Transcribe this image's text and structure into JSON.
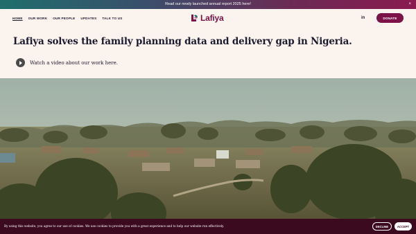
{
  "announcement": {
    "text": "Read our newly launched annual report 2025 here!",
    "close": "×"
  },
  "nav": {
    "items": [
      "HOME",
      "OUR WORK",
      "OUR PEOPLE",
      "UPDATES",
      "TALK TO US"
    ],
    "active": "HOME"
  },
  "logo": {
    "text": "Lafiya"
  },
  "header_right": {
    "linkedin": "in",
    "donate": "DONATE"
  },
  "hero_text": {
    "headline": "Lafiya solves the family planning data and delivery gap in Nigeria.",
    "video_link": "Watch a video about our work here."
  },
  "cookie": {
    "message": "By using this website, you agree to our use of cookies. We use cookies to provide you with a great experience and to help our website run effectively.",
    "decline": "DECLINE",
    "accept": "ACCEPT"
  },
  "colors": {
    "brand": "#7b1248",
    "text": "#1b1b2e",
    "background": "#fbf3ee",
    "cookie_bar": "#3b0a1e"
  },
  "icons": {
    "play": "play-icon",
    "linkedin": "linkedin-icon",
    "logo": "lafiya-logo-mark"
  }
}
